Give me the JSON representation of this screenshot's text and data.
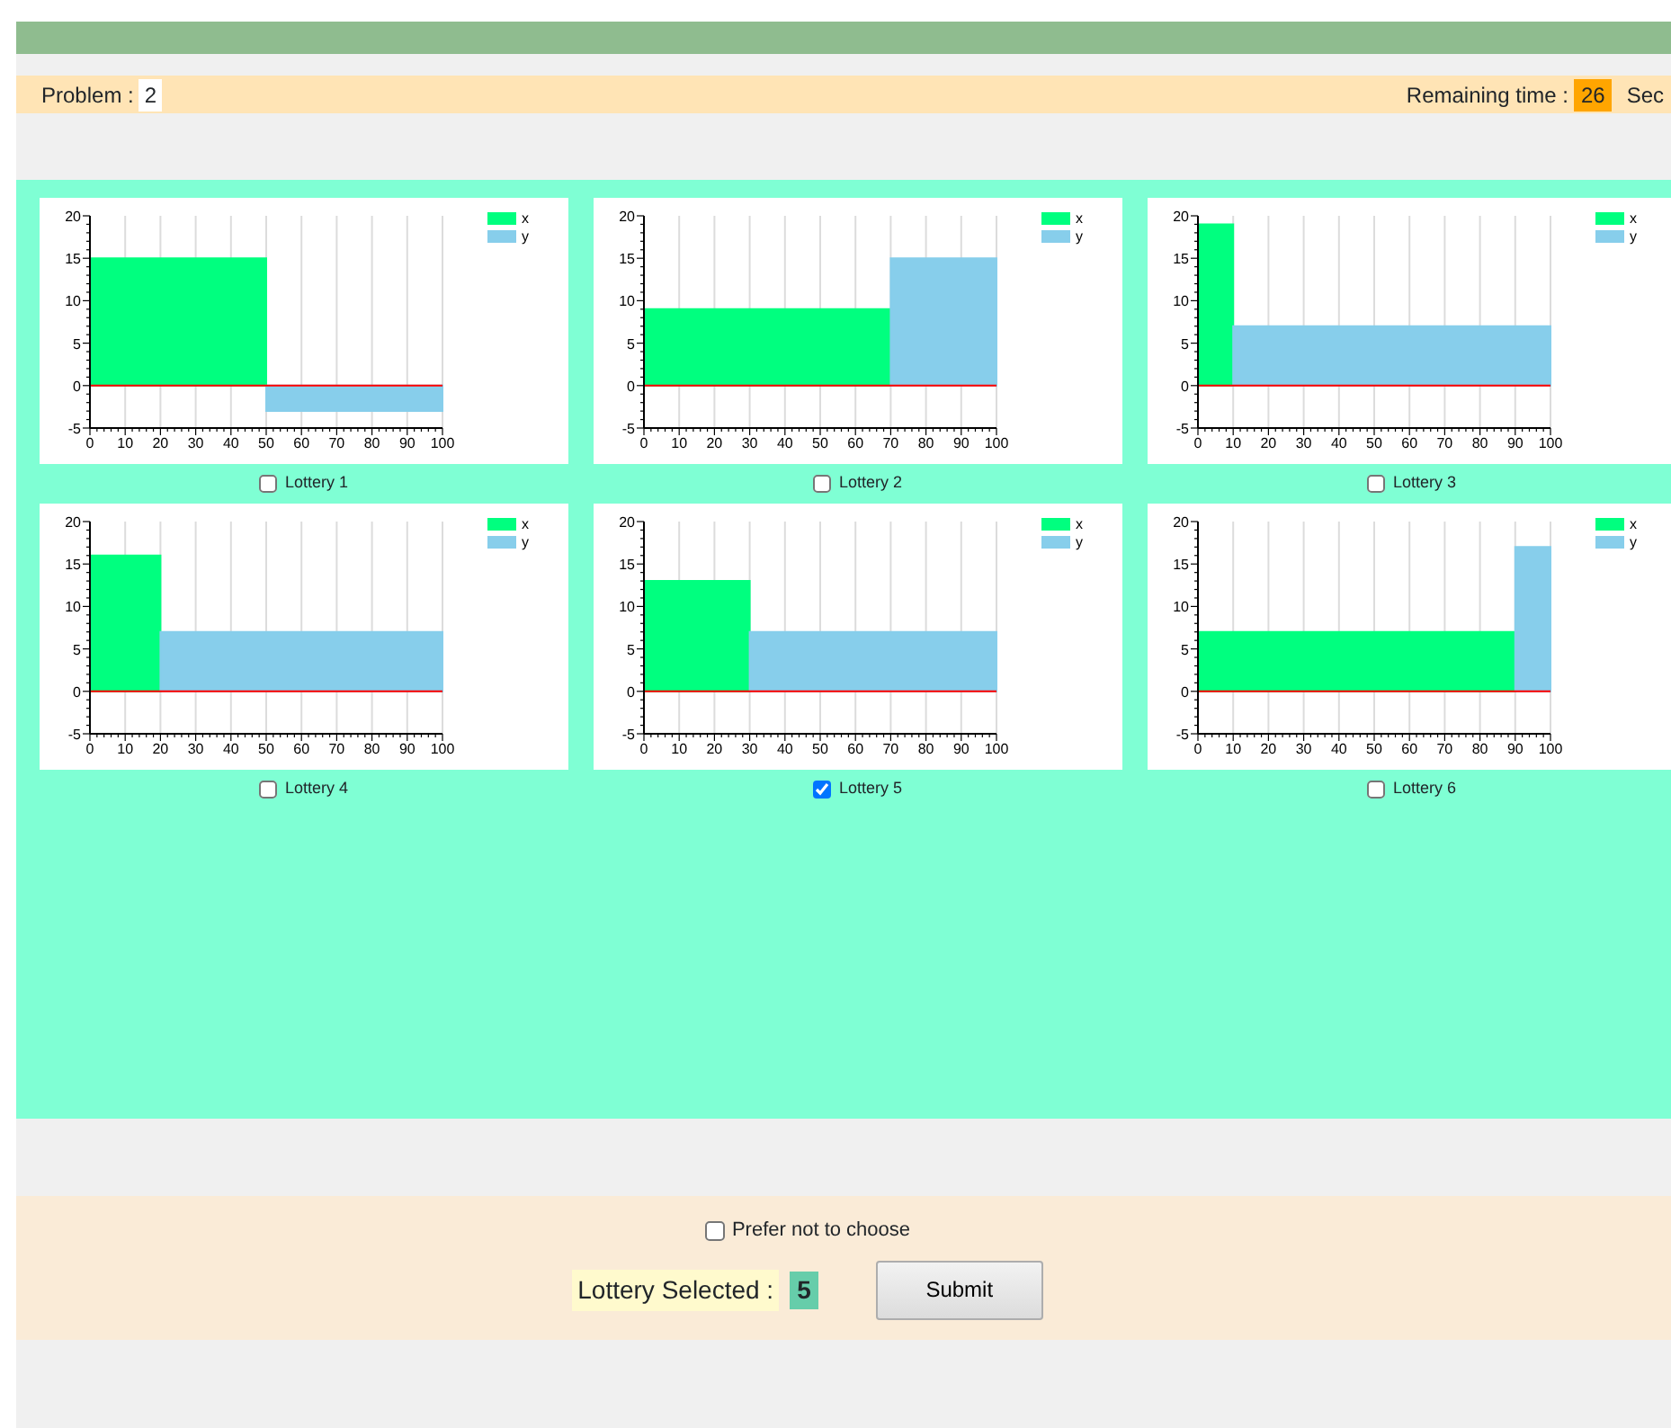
{
  "header": {
    "problem_label": "Problem :",
    "problem_value": "2",
    "time_label": "Remaining time :",
    "time_value": "26",
    "time_unit": "Sec"
  },
  "lotteries": [
    {
      "label": "Lottery 1",
      "checked": false,
      "chart_data": {
        "type": "area",
        "grid": true,
        "legend": true,
        "ref_lines": [
          {
            "axis": "y",
            "value": 0,
            "color": "#ff0000"
          }
        ],
        "x": [
          0,
          50,
          50,
          100
        ],
        "xlim": [
          0,
          100
        ],
        "ylim": [
          -5,
          20
        ],
        "xticks": [
          0,
          10,
          20,
          30,
          40,
          50,
          60,
          70,
          80,
          90,
          100
        ],
        "yticks": [
          -5,
          0,
          5,
          10,
          15,
          20
        ],
        "series": [
          {
            "name": "x",
            "color": "#00ff7f",
            "values": [
              15,
              15,
              null,
              null
            ]
          },
          {
            "name": "y",
            "color": "#87ceeb",
            "values": [
              null,
              null,
              -3,
              -3
            ]
          }
        ]
      }
    },
    {
      "label": "Lottery 2",
      "checked": false,
      "chart_data": {
        "type": "area",
        "grid": true,
        "legend": true,
        "ref_lines": [
          {
            "axis": "y",
            "value": 0,
            "color": "#ff0000"
          }
        ],
        "x": [
          0,
          70,
          70,
          100
        ],
        "xlim": [
          0,
          100
        ],
        "ylim": [
          -5,
          20
        ],
        "xticks": [
          0,
          10,
          20,
          30,
          40,
          50,
          60,
          70,
          80,
          90,
          100
        ],
        "yticks": [
          -5,
          0,
          5,
          10,
          15,
          20
        ],
        "series": [
          {
            "name": "x",
            "color": "#00ff7f",
            "values": [
              9,
              9,
              null,
              null
            ]
          },
          {
            "name": "y",
            "color": "#87ceeb",
            "values": [
              null,
              null,
              15,
              15
            ]
          }
        ]
      }
    },
    {
      "label": "Lottery 3",
      "checked": false,
      "chart_data": {
        "type": "area",
        "grid": true,
        "legend": true,
        "ref_lines": [
          {
            "axis": "y",
            "value": 0,
            "color": "#ff0000"
          }
        ],
        "x": [
          0,
          10,
          10,
          100
        ],
        "xlim": [
          0,
          100
        ],
        "ylim": [
          -5,
          20
        ],
        "xticks": [
          0,
          10,
          20,
          30,
          40,
          50,
          60,
          70,
          80,
          90,
          100
        ],
        "yticks": [
          -5,
          0,
          5,
          10,
          15,
          20
        ],
        "series": [
          {
            "name": "x",
            "color": "#00ff7f",
            "values": [
              19,
              19,
              null,
              null
            ]
          },
          {
            "name": "y",
            "color": "#87ceeb",
            "values": [
              null,
              null,
              7,
              7
            ]
          }
        ]
      }
    },
    {
      "label": "Lottery 4",
      "checked": false,
      "chart_data": {
        "type": "area",
        "grid": true,
        "legend": true,
        "ref_lines": [
          {
            "axis": "y",
            "value": 0,
            "color": "#ff0000"
          }
        ],
        "x": [
          0,
          20,
          20,
          100
        ],
        "xlim": [
          0,
          100
        ],
        "ylim": [
          -5,
          20
        ],
        "xticks": [
          0,
          10,
          20,
          30,
          40,
          50,
          60,
          70,
          80,
          90,
          100
        ],
        "yticks": [
          -5,
          0,
          5,
          10,
          15,
          20
        ],
        "series": [
          {
            "name": "x",
            "color": "#00ff7f",
            "values": [
              16,
              16,
              null,
              null
            ]
          },
          {
            "name": "y",
            "color": "#87ceeb",
            "values": [
              null,
              null,
              7,
              7
            ]
          }
        ]
      }
    },
    {
      "label": "Lottery 5",
      "checked": true,
      "chart_data": {
        "type": "area",
        "grid": true,
        "legend": true,
        "ref_lines": [
          {
            "axis": "y",
            "value": 0,
            "color": "#ff0000"
          }
        ],
        "x": [
          0,
          30,
          30,
          100
        ],
        "xlim": [
          0,
          100
        ],
        "ylim": [
          -5,
          20
        ],
        "xticks": [
          0,
          10,
          20,
          30,
          40,
          50,
          60,
          70,
          80,
          90,
          100
        ],
        "yticks": [
          -5,
          0,
          5,
          10,
          15,
          20
        ],
        "series": [
          {
            "name": "x",
            "color": "#00ff7f",
            "values": [
              13,
              13,
              null,
              null
            ]
          },
          {
            "name": "y",
            "color": "#87ceeb",
            "values": [
              null,
              null,
              7,
              7
            ]
          }
        ]
      }
    },
    {
      "label": "Lottery 6",
      "checked": false,
      "chart_data": {
        "type": "area",
        "grid": true,
        "legend": true,
        "ref_lines": [
          {
            "axis": "y",
            "value": 0,
            "color": "#ff0000"
          }
        ],
        "x": [
          0,
          90,
          90,
          100
        ],
        "xlim": [
          0,
          100
        ],
        "ylim": [
          -5,
          20
        ],
        "xticks": [
          0,
          10,
          20,
          30,
          40,
          50,
          60,
          70,
          80,
          90,
          100
        ],
        "yticks": [
          -5,
          0,
          5,
          10,
          15,
          20
        ],
        "series": [
          {
            "name": "x",
            "color": "#00ff7f",
            "values": [
              7,
              7,
              null,
              null
            ]
          },
          {
            "name": "y",
            "color": "#87ceeb",
            "values": [
              null,
              null,
              17,
              17
            ]
          }
        ]
      }
    }
  ],
  "footer": {
    "prefer_label": "Prefer not to choose",
    "prefer_checked": false,
    "selected_label": "Lottery Selected :",
    "selected_value": "5",
    "submit": "Submit"
  }
}
